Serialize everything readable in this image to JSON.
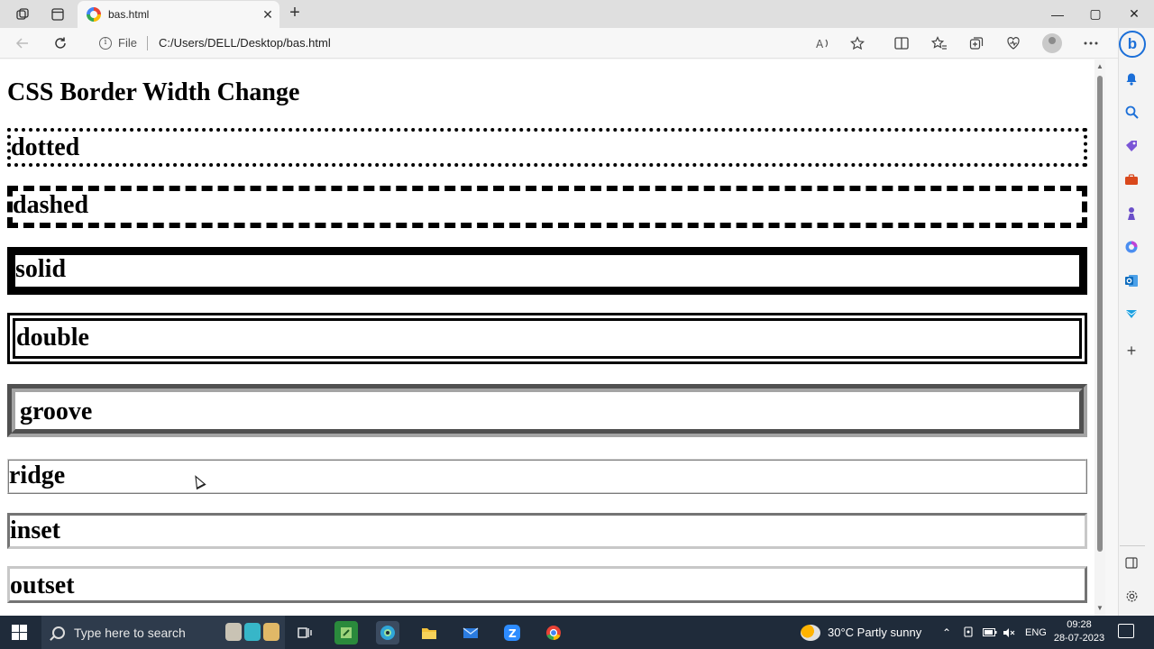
{
  "browser": {
    "tab_title": "bas.html",
    "tab_close": "✕",
    "new_tab": "+",
    "minimize": "—",
    "maximize": "▢",
    "close": "✕",
    "address_prefix": "File",
    "address_url": "C:/Users/DELL/Desktop/bas.html"
  },
  "page": {
    "heading": "CSS Border Width Change",
    "boxes": [
      {
        "label": "dotted",
        "style": "dotted"
      },
      {
        "label": "dashed",
        "style": "dashed"
      },
      {
        "label": "solid",
        "style": "solid"
      },
      {
        "label": "double",
        "style": "double"
      },
      {
        "label": "groove",
        "style": "groove"
      },
      {
        "label": "ridge",
        "style": "ridge"
      },
      {
        "label": "inset",
        "style": "inset"
      },
      {
        "label": "outset",
        "style": "outset"
      }
    ]
  },
  "taskbar": {
    "search_placeholder": "Type here to search",
    "weather": "30°C  Partly sunny",
    "language": "ENG",
    "time": "09:28",
    "date": "28-07-2023"
  },
  "colors": {
    "taskbar_bg": "#1f2b3a",
    "bing_blue": "#1b6fd8",
    "groove_gray": "#a4a4a4"
  }
}
